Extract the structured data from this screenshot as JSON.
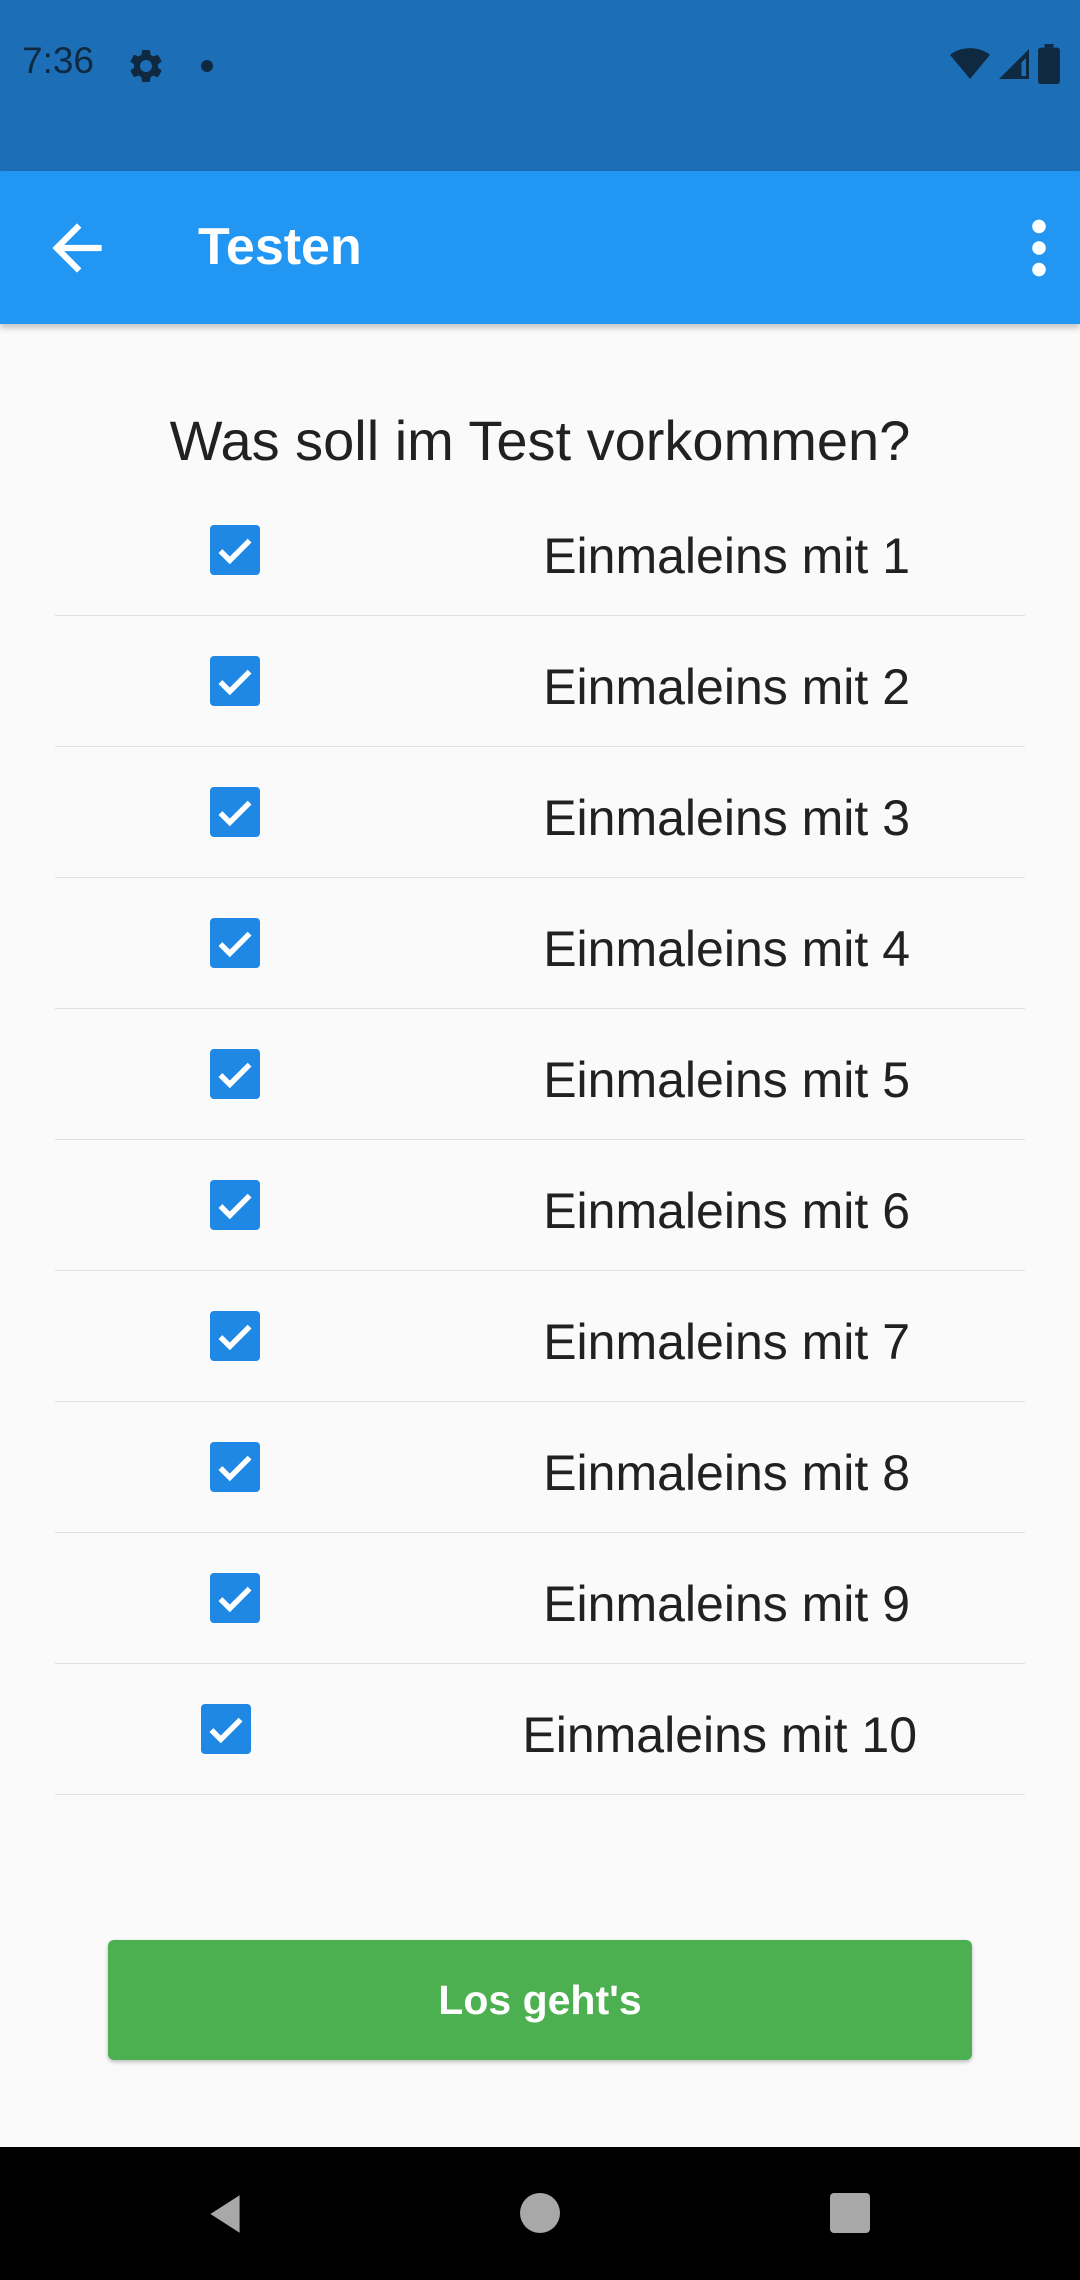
{
  "status_bar": {
    "time": "7:36",
    "icons": [
      "gear-icon",
      "notification-dot-icon",
      "wifi-icon",
      "signal-icon",
      "battery-icon"
    ]
  },
  "app_bar": {
    "title": "Testen",
    "back_icon": "arrow-back-icon",
    "menu_icon": "more-vert-icon",
    "color": "#2196f3"
  },
  "main": {
    "question": "Was soll im Test vorkommen?",
    "options": [
      {
        "label": "Einmaleins mit 1",
        "checked": true
      },
      {
        "label": "Einmaleins mit 2",
        "checked": true
      },
      {
        "label": "Einmaleins mit 3",
        "checked": true
      },
      {
        "label": "Einmaleins mit 4",
        "checked": true
      },
      {
        "label": "Einmaleins mit 5",
        "checked": true
      },
      {
        "label": "Einmaleins mit 6",
        "checked": true
      },
      {
        "label": "Einmaleins mit 7",
        "checked": true
      },
      {
        "label": "Einmaleins mit 8",
        "checked": true
      },
      {
        "label": "Einmaleins mit 9",
        "checked": true
      },
      {
        "label": "Einmaleins mit 10",
        "checked": true
      }
    ],
    "start_button_label": "Los geht's",
    "checkbox_color": "#1f88e5",
    "button_color": "#4caf50"
  },
  "nav_bar": {
    "icons": [
      "nav-back-icon",
      "nav-home-icon",
      "nav-recents-icon"
    ]
  }
}
